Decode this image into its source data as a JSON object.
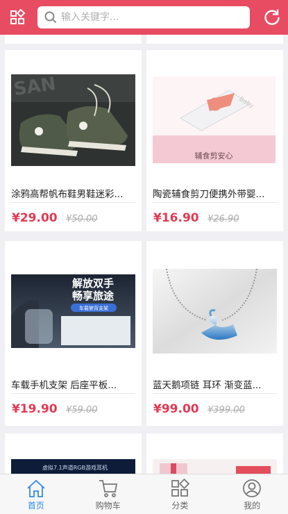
{
  "header": {
    "search_placeholder": "输入关键字...",
    "brand_color": "#e84c62"
  },
  "products": [
    {
      "title": "涂鸦高帮帆布鞋男鞋迷彩...",
      "price": "¥29.00",
      "old_price": "¥50.00"
    },
    {
      "title": "陶瓷辅食剪刀便携外带婴...",
      "price": "¥16.90",
      "old_price": "¥26.90",
      "image_text": "辅食剪安心"
    },
    {
      "title": "车载手机支架 后座平板...",
      "price": "¥19.90",
      "old_price": "¥59.00",
      "image_text_1": "解放双手",
      "image_text_2": "畅享旅途",
      "image_text_3": "车载俯背支架"
    },
    {
      "title": "蓝天鹅项链 耳环 渐变蓝...",
      "price": "¥99.00",
      "old_price": "¥399.00"
    },
    {
      "image_text": "虚拟7.1声道RGB游戏耳机"
    }
  ],
  "tabbar": {
    "items": [
      {
        "label": "首页",
        "icon": "home-icon",
        "active": true
      },
      {
        "label": "购物车",
        "icon": "cart-icon"
      },
      {
        "label": "分类",
        "icon": "category-icon"
      },
      {
        "label": "我的",
        "icon": "user-icon"
      }
    ],
    "active_color": "#2f8be6"
  }
}
